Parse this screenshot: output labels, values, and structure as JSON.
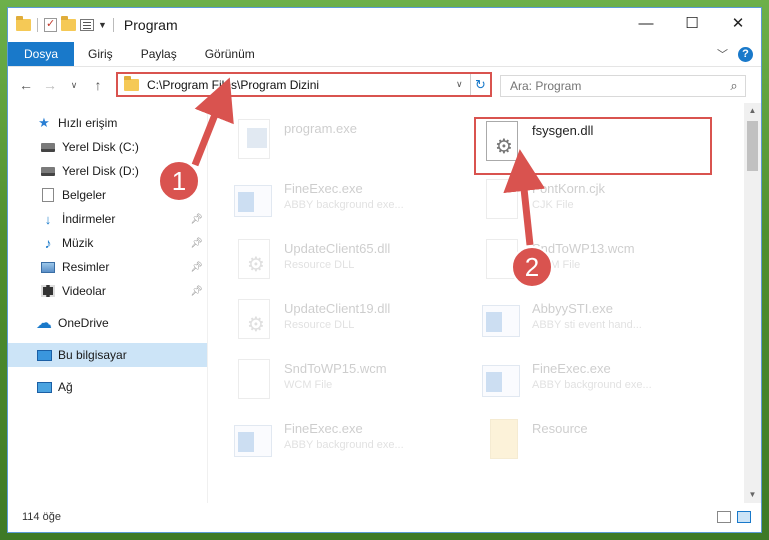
{
  "window": {
    "title": "Program",
    "controls": {
      "minimize": "—",
      "maximize": "☐",
      "close": "✕"
    }
  },
  "ribbon": {
    "tabs": [
      {
        "label": "Dosya"
      },
      {
        "label": "Giriş"
      },
      {
        "label": "Paylaş"
      },
      {
        "label": "Görünüm"
      }
    ],
    "help": "?"
  },
  "nav": {
    "address": "C:\\Program Files\\Program Dizini",
    "search_placeholder": "Ara: Program"
  },
  "sidebar": {
    "items": [
      {
        "label": "Hızlı erişim",
        "icon": "star-icon"
      },
      {
        "label": "Yerel Disk (C:)",
        "icon": "drive-icon"
      },
      {
        "label": "Yerel Disk (D:)",
        "icon": "drive-icon"
      },
      {
        "label": "Belgeler",
        "icon": "document-icon"
      },
      {
        "label": "İndirmeler",
        "icon": "download-icon",
        "pinned": true
      },
      {
        "label": "Müzik",
        "icon": "music-icon",
        "pinned": true
      },
      {
        "label": "Resimler",
        "icon": "pictures-icon",
        "pinned": true
      },
      {
        "label": "Videolar",
        "icon": "video-icon",
        "pinned": true
      },
      {
        "label": "OneDrive",
        "icon": "onedrive-icon"
      },
      {
        "label": "Bu bilgisayar",
        "icon": "computer-icon",
        "selected": true
      },
      {
        "label": "Ağ",
        "icon": "network-icon"
      }
    ]
  },
  "files": [
    {
      "name": "program.exe",
      "sub": "",
      "icon": "exe-icon",
      "faded": true
    },
    {
      "name": "fsysgen.dll",
      "sub": "",
      "icon": "dll-icon",
      "faded": false
    },
    {
      "name": "FineExec.exe",
      "sub": "ABBY background exe...",
      "icon": "app-icon",
      "faded": true
    },
    {
      "name": "FontKorn.cjk",
      "sub": "CJK File",
      "icon": "file-icon",
      "faded": true
    },
    {
      "name": "UpdateClient65.dll",
      "sub": "Resource DLL",
      "icon": "dll-icon",
      "faded": true
    },
    {
      "name": "SndToWP13.wcm",
      "sub": "WCM File",
      "icon": "file-icon",
      "faded": true
    },
    {
      "name": "UpdateClient19.dll",
      "sub": "Resource DLL",
      "icon": "dll-icon",
      "faded": true
    },
    {
      "name": "AbbyySTI.exe",
      "sub": "ABBY sti event hand...",
      "icon": "app-icon",
      "faded": true
    },
    {
      "name": "SndToWP15.wcm",
      "sub": "WCM File",
      "icon": "file-icon",
      "faded": true
    },
    {
      "name": "FineExec.exe",
      "sub": "ABBY background exe...",
      "icon": "app-icon",
      "faded": true
    },
    {
      "name": "FineExec.exe",
      "sub": "ABBY background exe...",
      "icon": "app-icon",
      "faded": true
    },
    {
      "name": "Resource",
      "sub": "",
      "icon": "folder-icon",
      "faded": true
    }
  ],
  "annotations": {
    "step1": "1",
    "step2": "2"
  },
  "status": {
    "count": "114 öğe"
  },
  "colors": {
    "accent": "#1979ca",
    "highlight": "#d9534f"
  }
}
